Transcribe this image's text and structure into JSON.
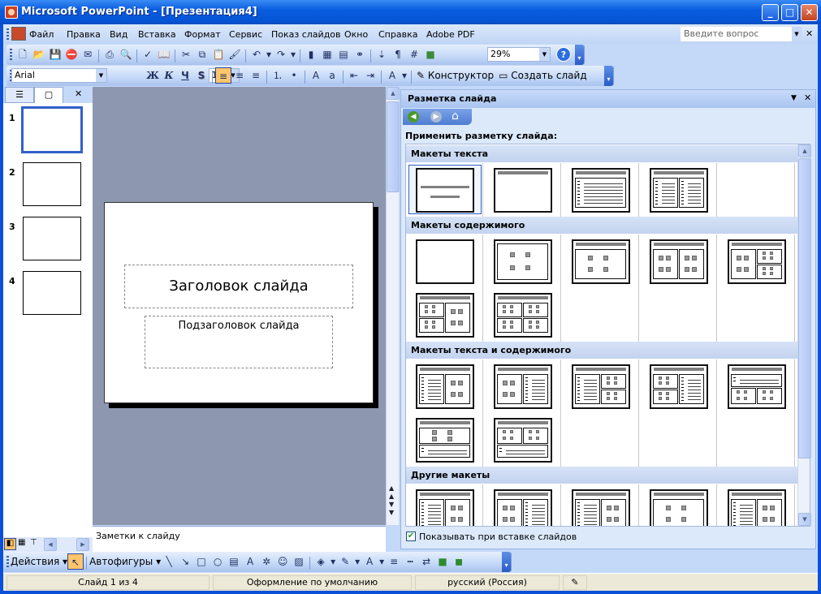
{
  "window": {
    "title": "Microsoft PowerPoint - [Презентация4]",
    "min": "_",
    "max": "□",
    "close": "✕"
  },
  "menu": {
    "items": [
      "Файл",
      "Правка",
      "Вид",
      "Вставка",
      "Формат",
      "Сервис",
      "Показ слайдов",
      "Окно",
      "Справка",
      "Adobe PDF"
    ],
    "help_placeholder": "Введите вопрос",
    "close": "✕"
  },
  "standard_toolbar": {
    "icons_left": [
      "new-icon",
      "open-icon",
      "save-icon",
      "permission-icon",
      "email-icon",
      "|",
      "print-icon",
      "print-preview-icon",
      "|",
      "spelling-icon",
      "research-icon",
      "|",
      "cut-icon",
      "copy-icon",
      "paste-icon",
      "format-painter-icon",
      "|",
      "undo-icon",
      "dropdown-icon",
      "redo-icon",
      "dropdown-icon",
      "|",
      "chart-icon",
      "table-icon",
      "tables-borders-icon",
      "hyperlink-icon",
      "|",
      "expand-icon",
      "show-formatting-icon",
      "grid-icon",
      "color-grayscale-icon"
    ],
    "zoom": "29%",
    "help": "?"
  },
  "format_toolbar": {
    "font": "Arial",
    "size": "18",
    "bold": "Ж",
    "italic": "К",
    "underline": "Ч",
    "shadow": "S",
    "design": "Конструктор",
    "new_slide": "Создать слайд",
    "icons": [
      "align-left-icon",
      "center-icon",
      "align-right-icon",
      "|",
      "numbering-icon",
      "bullets-icon",
      "|",
      "increase-font-icon",
      "decrease-font-icon",
      "|",
      "decrease-indent-icon",
      "increase-indent-icon",
      "|",
      "font-color-icon",
      "dropdown-icon"
    ]
  },
  "left_pane": {
    "close": "✕",
    "slides": [
      "1",
      "2",
      "3",
      "4"
    ]
  },
  "slide": {
    "title": "Заголовок слайда",
    "subtitle": "Подзаголовок слайда"
  },
  "notes": {
    "placeholder": "Заметки к слайду"
  },
  "task_pane": {
    "title": "Разметка слайда",
    "apply_label": "Применить разметку слайда:",
    "show_on_insert": "Показывать при вставке слайдов",
    "show_on_insert_checked": true,
    "sections": [
      {
        "title": "Макеты текста",
        "rows": [
          [
            "title-slide",
            "title-only",
            "title-text",
            "title-two-text"
          ]
        ]
      },
      {
        "title": "Макеты содержимого",
        "rows": [
          [
            "blank",
            "content",
            "title-content",
            "title-two-content",
            "title-content-two-small"
          ],
          [
            "title-two-small-content",
            "title-four-content"
          ]
        ]
      },
      {
        "title": "Макеты текста и содержимого",
        "rows": [
          [
            "title-text-content",
            "title-content-text",
            "title-text-two-small",
            "title-two-small-text",
            "title-text-over-content"
          ],
          [
            "title-content-over-text",
            "title-content-over-text-2"
          ]
        ]
      },
      {
        "title": "Другие макеты",
        "rows": [
          [
            "title-text-clipart",
            "title-clipart-text",
            "title-text-chart",
            "title-chart",
            "title-text-media"
          ]
        ]
      }
    ]
  },
  "drawing_toolbar": {
    "actions": "Действия",
    "autoshapes": "Автофигуры",
    "icons": [
      "line-icon",
      "arrow-icon",
      "rectangle-icon",
      "oval-icon",
      "textbox-icon",
      "wordart-icon",
      "diagram-icon",
      "clipart-icon",
      "picture-icon",
      "|",
      "fill-color-icon",
      "dropdown-icon",
      "line-color-icon",
      "dropdown-icon",
      "font-color-icon",
      "dropdown-icon",
      "line-style-icon",
      "dash-style-icon",
      "arrow-style-icon",
      "shadow-icon",
      "3d-icon"
    ]
  },
  "status": {
    "slide": "Слайд 1 из 4",
    "design": "Оформление по умолчанию",
    "language": "русский (Россия)"
  }
}
